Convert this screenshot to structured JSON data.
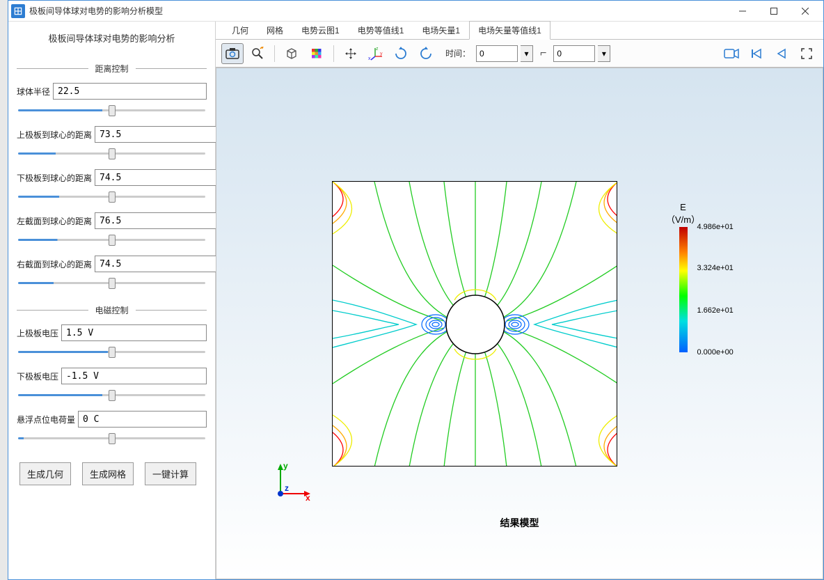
{
  "window_title": "极板间导体球对电势的影响分析模型",
  "sidebar": {
    "title": "极板间导体球对电势的影响分析",
    "group1": "距离控制",
    "group2": "电磁控制",
    "fields": {
      "sphere_radius": {
        "label": "球体半径",
        "value": "22.5",
        "pct": 45
      },
      "top_plate_dist": {
        "label": "上极板到球心的距离",
        "value": "73.5",
        "pct": 20
      },
      "bot_plate_dist": {
        "label": "下极板到球心的距离",
        "value": "74.5",
        "pct": 22
      },
      "left_plane_dist": {
        "label": "左截面到球心的距离",
        "value": "76.5",
        "pct": 21
      },
      "right_plane_dist": {
        "label": "右截面到球心的距离",
        "value": "74.5",
        "pct": 19
      },
      "top_voltage": {
        "label": "上极板电压",
        "value": "1.5 V",
        "pct": 48
      },
      "bot_voltage": {
        "label": "下极板电压",
        "value": "-1.5 V",
        "pct": 45
      },
      "float_charge": {
        "label": "悬浮点位电荷量",
        "value": "0 C",
        "pct": 3
      }
    },
    "buttons": {
      "gen_geom": "生成几何",
      "gen_mesh": "生成网格",
      "compute": "一键计算"
    }
  },
  "tabs": [
    "几何",
    "网格",
    "电势云图1",
    "电势等值线1",
    "电场矢量1",
    "电场矢量等值线1"
  ],
  "active_tab": 5,
  "toolbar": {
    "time_label": "时间：",
    "time1": "0",
    "time2": "0"
  },
  "canvas": {
    "result_title": "结果模型",
    "axis_y": "y",
    "axis_x": "x",
    "axis_z": "z"
  },
  "colorbar": {
    "title": "E",
    "unit": "（V/m）",
    "labels": [
      {
        "text": "4.986e+01",
        "pos": 0
      },
      {
        "text": "3.324e+01",
        "pos": 33
      },
      {
        "text": "1.662e+01",
        "pos": 67
      },
      {
        "text": "0.000e+00",
        "pos": 100
      }
    ]
  }
}
